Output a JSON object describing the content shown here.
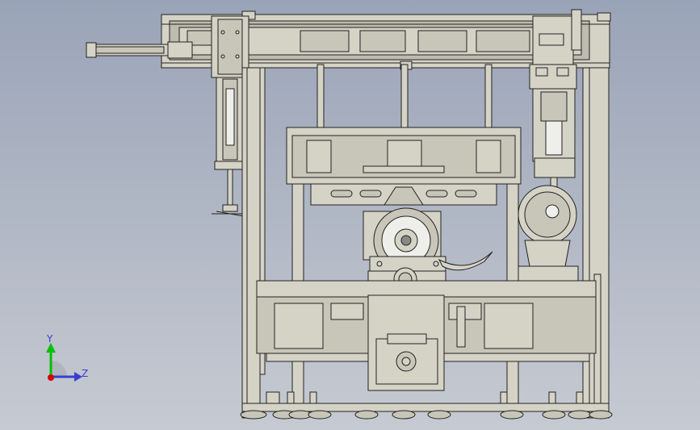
{
  "viewport": {
    "background_top": "#9aa4b8",
    "background_bottom": "#c6cad2"
  },
  "model": {
    "frame_fill": "#d5d3c6",
    "edge_color": "#222222",
    "face_shade": "#bebcae"
  },
  "triad": {
    "y_label": "Y",
    "z_label": "Z",
    "y_color": "#00c000",
    "z_color": "#3a3fd0",
    "x_color": "#d40000"
  }
}
